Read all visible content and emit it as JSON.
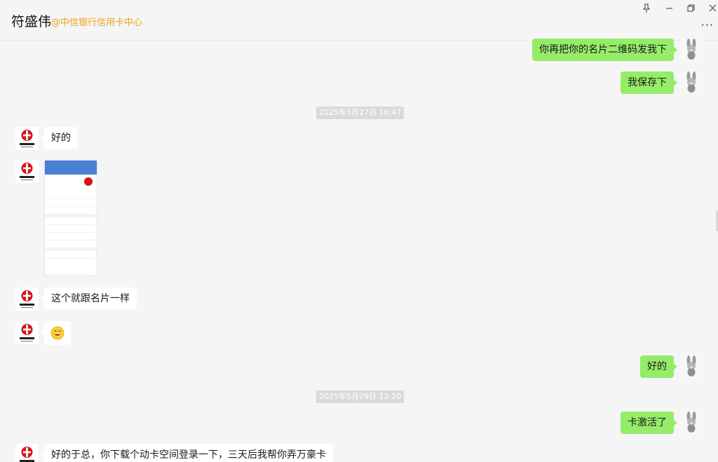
{
  "header": {
    "name": "符盛伟",
    "subtitle": "@中信银行信用卡中心"
  },
  "window_icons": {
    "pin": "pin-icon",
    "minimize": "minimize-icon",
    "restore": "restore-icon",
    "close": "close-icon",
    "more": "more-icon"
  },
  "messages": [
    {
      "from": "me",
      "text": "你再把你的名片二维码发我下"
    },
    {
      "from": "me",
      "text": "我保存下"
    },
    {
      "from": "system",
      "text": "2025年5月27日 16:47"
    },
    {
      "from": "them",
      "text": "好的"
    },
    {
      "from": "them",
      "type": "image"
    },
    {
      "from": "them",
      "text": "这个就跟名片一样"
    },
    {
      "from": "them",
      "type": "emoji",
      "text": "😄"
    },
    {
      "from": "me",
      "text": "好的"
    },
    {
      "from": "system",
      "text": "2025年5月29日 12:20"
    },
    {
      "from": "me",
      "text": "卡激活了"
    },
    {
      "from": "them",
      "text": "好的于总，你下载个动卡空间登录一下，三天后我帮你弄万豪卡"
    }
  ],
  "colors": {
    "my_bubble": "#95ec69",
    "their_bubble": "#ffffff",
    "subtitle": "#f0a020",
    "background": "#f5f5f5"
  }
}
